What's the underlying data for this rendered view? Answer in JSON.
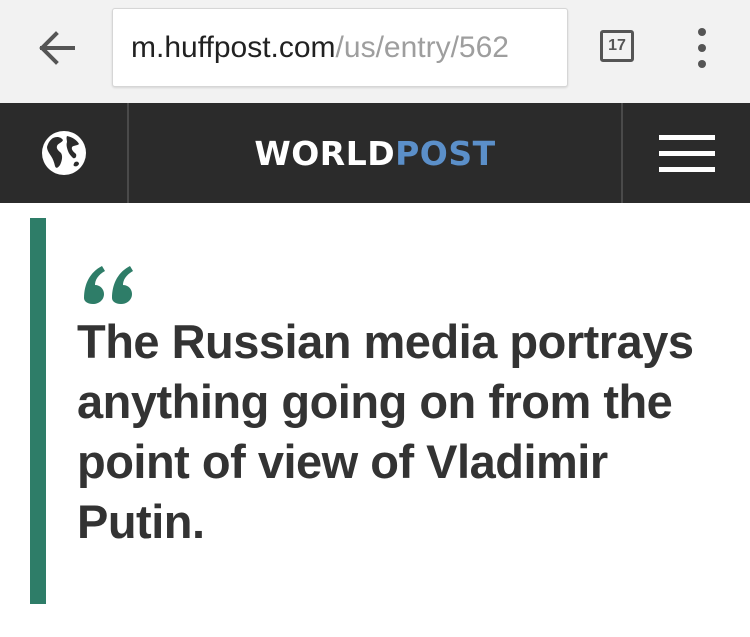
{
  "browser": {
    "url_host": "m.huffpost.com",
    "url_path": "/us/entry/562",
    "tab_count": "17",
    "icons": {
      "back": "arrow-left-icon",
      "menu": "vertical-dots-icon"
    }
  },
  "header": {
    "logo_part1": "WORLD",
    "logo_part2": "POST",
    "logo_colors": {
      "world": "#ffffff",
      "post": "#5b8fc9"
    },
    "background": "#2b2b2b",
    "icons": {
      "left": "globe-icon",
      "right": "hamburger-menu-icon"
    }
  },
  "quote": {
    "accent_color": "#2e7d68",
    "text": "The Russian media portrays anything going on from the point of view of Vladimir Putin."
  }
}
